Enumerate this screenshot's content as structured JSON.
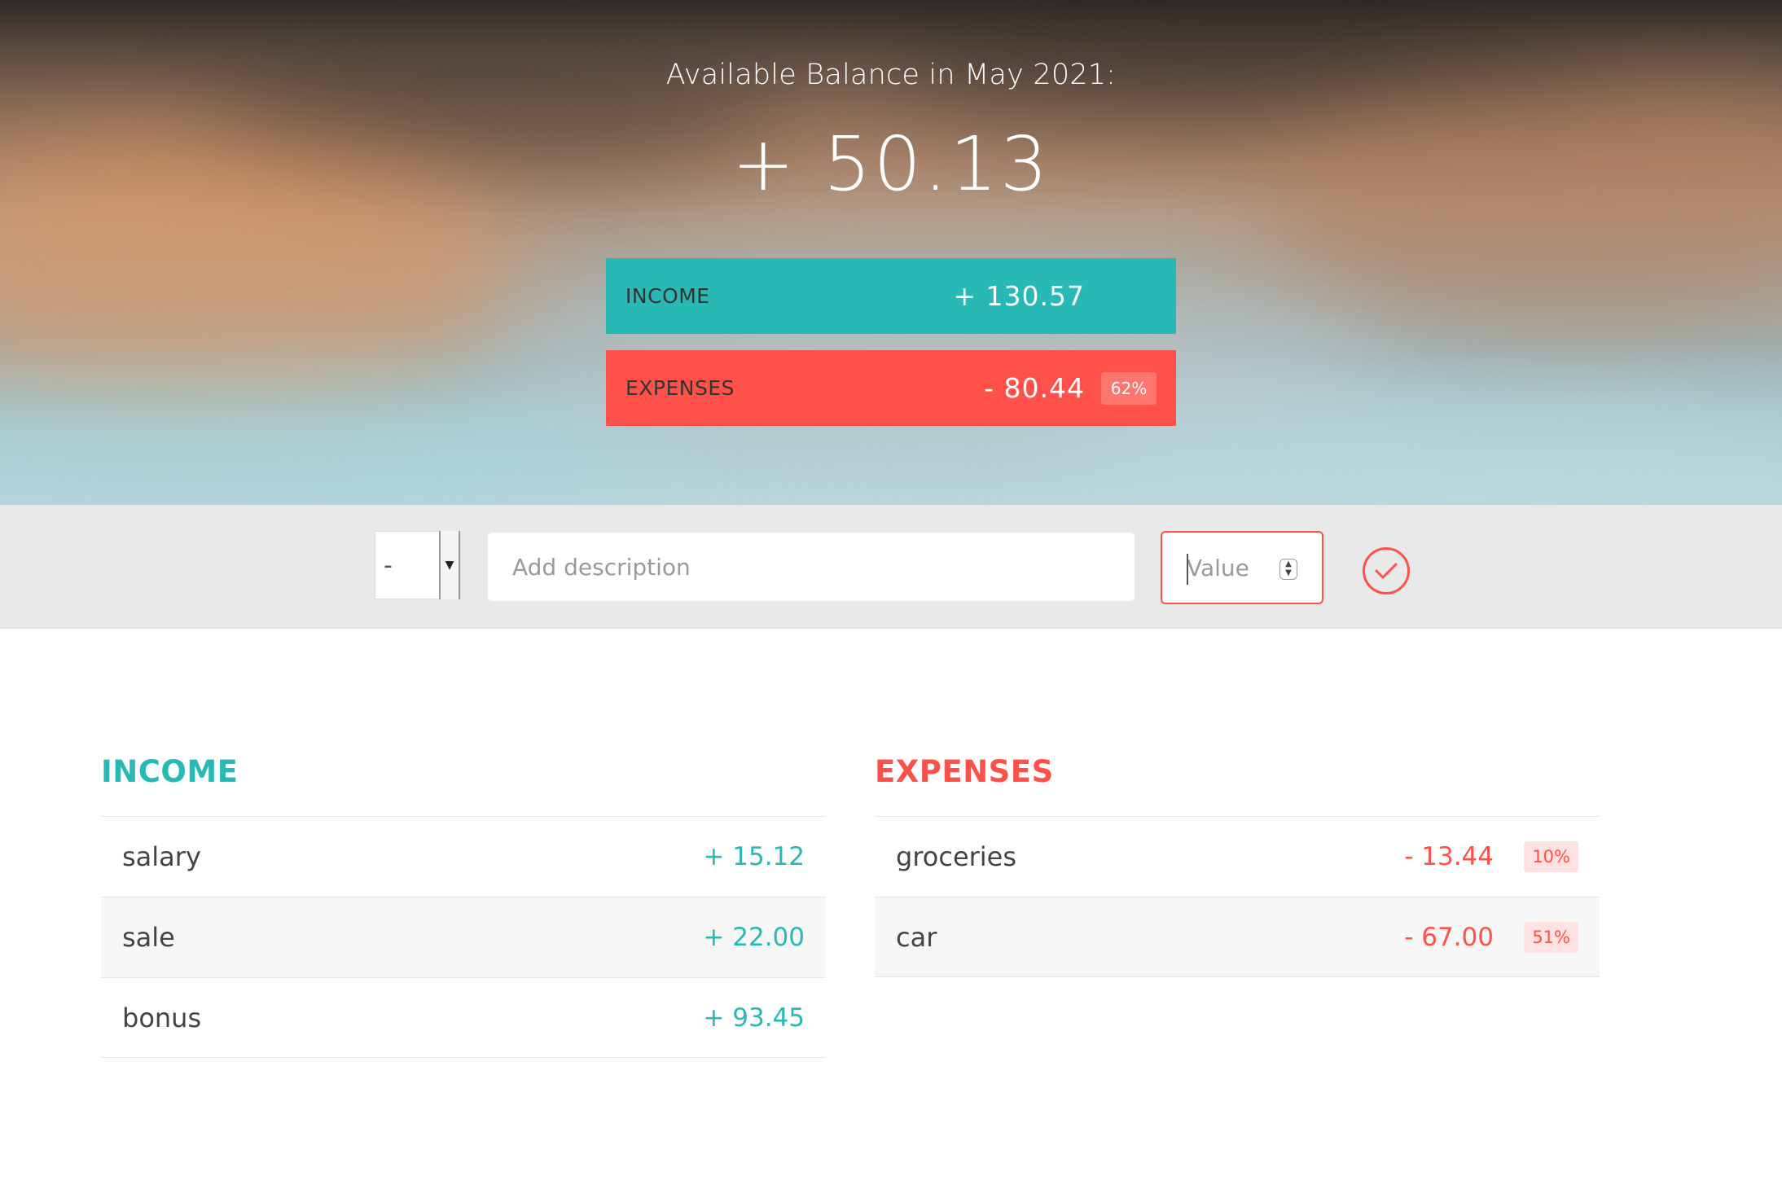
{
  "header": {
    "title": "Available Balance in May 2021:",
    "balance": "+ 50.13"
  },
  "summary": {
    "income": {
      "label": "INCOME",
      "value": "+ 130.57"
    },
    "expenses": {
      "label": "EXPENSES",
      "value": "- 80.44",
      "percentage": "62%"
    }
  },
  "add_form": {
    "type_selected": "-",
    "type_options": [
      "+",
      "-"
    ],
    "description_placeholder": "Add description",
    "value_placeholder": "Value",
    "submit_icon": "checkmark-circle-icon"
  },
  "income": {
    "title": "INCOME",
    "items": [
      {
        "description": "salary",
        "value": "+ 15.12"
      },
      {
        "description": "sale",
        "value": "+ 22.00"
      },
      {
        "description": "bonus",
        "value": "+ 93.45"
      }
    ]
  },
  "expenses": {
    "title": "EXPENSES",
    "items": [
      {
        "description": "groceries",
        "value": "- 13.44",
        "percentage": "10%"
      },
      {
        "description": "car",
        "value": "- 67.00",
        "percentage": "51%"
      }
    ]
  },
  "colors": {
    "income": "#28b9b5",
    "expenses": "#ff5049",
    "add_bar": "#e9e9e9"
  }
}
